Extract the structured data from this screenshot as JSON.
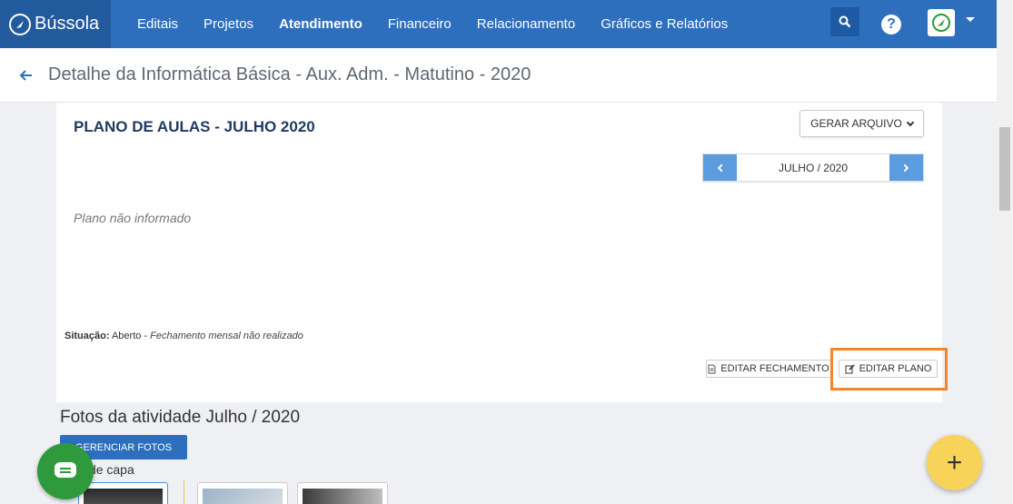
{
  "brand": {
    "name": "Bússola"
  },
  "nav": {
    "items": [
      "Editais",
      "Projetos",
      "Atendimento",
      "Financeiro",
      "Relacionamento",
      "Gráficos e Relatórios"
    ],
    "active": "Atendimento"
  },
  "header": {
    "title": "Detalhe da Informática Básica - Aux. Adm. - Matutino - 2020"
  },
  "card": {
    "title": "PLANO DE AULAS - JULHO 2020",
    "generate_label": "GERAR ARQUIVO",
    "month_label": "JULHO / 2020",
    "plan_empty": "Plano não informado",
    "situacao_label": "Situação:",
    "situacao_value": "Aberto - ",
    "situacao_note": "Fechamento mensal não realizado",
    "edit_fechamento_label": "EDITAR FECHAMENTO",
    "edit_plano_label": "EDITAR PLANO"
  },
  "photos": {
    "title": "Fotos da atividade Julho / 2020",
    "manage_label": "GERENCIAR FOTOS",
    "cover_label": "Foto de capa"
  },
  "colors": {
    "nav": "#2d6fbd",
    "highlight": "#f5852b",
    "chat": "#2e9a3b",
    "fab": "#f8d35a"
  }
}
